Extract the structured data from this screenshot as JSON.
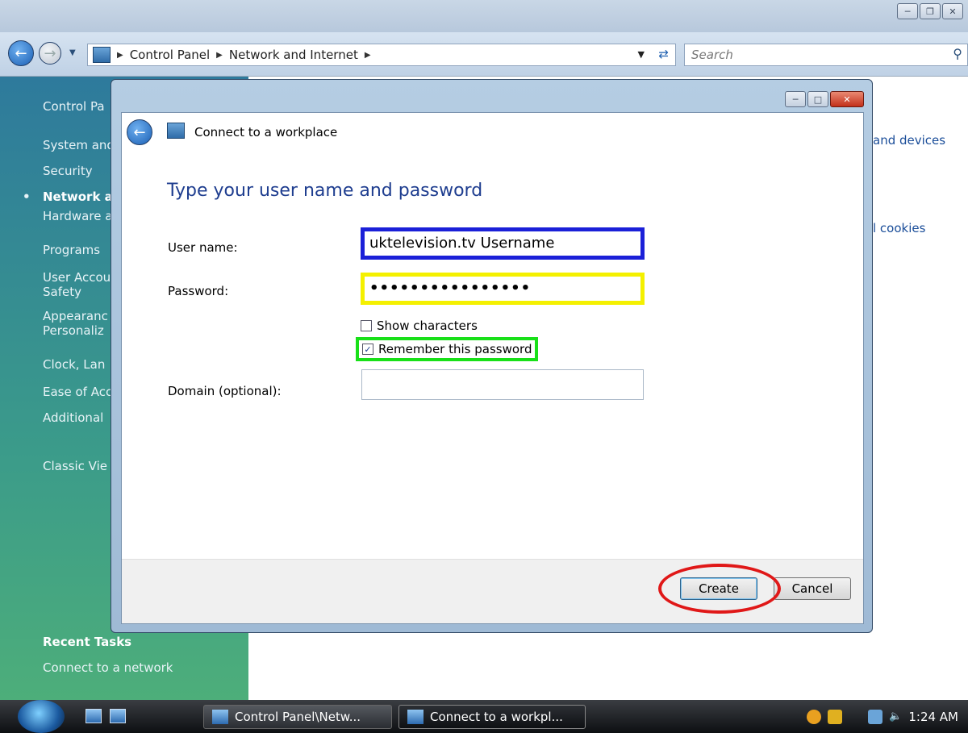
{
  "address": {
    "segments": [
      "Control Panel",
      "Network and Internet"
    ],
    "search_placeholder": "Search"
  },
  "sidebar": {
    "items": [
      "Control Pa",
      "System and",
      "Security",
      "Network a",
      "Hardware a",
      "Programs",
      "User Accou\nSafety",
      "Appearanc\nPersonaliz",
      "Clock, Lan",
      "Ease of Acc",
      "Additional",
      "Classic Vie"
    ],
    "recent_title": "Recent Tasks",
    "recent_item": "Connect to a network"
  },
  "right_pane": {
    "devices": "and devices",
    "cookies": "l cookies"
  },
  "dialog": {
    "title": "Connect to a workplace",
    "heading": "Type your user name and password",
    "username_label": "User name:",
    "username_value": "uktelevision.tv Username",
    "password_label": "Password:",
    "password_value": "••••••••••••••••",
    "show_chars_label": "Show characters",
    "remember_label": "Remember this password",
    "domain_label": "Domain (optional):",
    "domain_value": "",
    "create_label": "Create",
    "cancel_label": "Cancel"
  },
  "taskbar": {
    "task1": "Control Panel\\Netw...",
    "task2": "Connect to a workpl...",
    "clock": "1:24 AM"
  }
}
